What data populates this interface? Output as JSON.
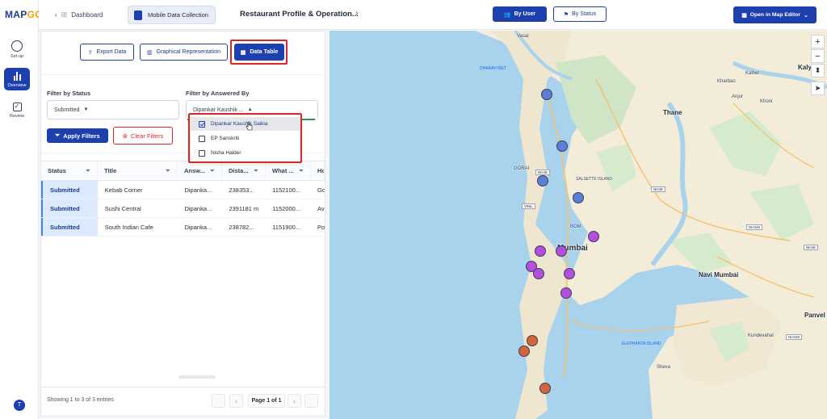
{
  "app": {
    "logo_main": "MAP",
    "logo_accent": "GG"
  },
  "rail": {
    "items": [
      {
        "label": "Set up",
        "icon": "gear-icon"
      },
      {
        "label": "Overview",
        "icon": "bar-chart-icon"
      },
      {
        "label": "Review",
        "icon": "checkbox-icon"
      }
    ],
    "avatar_initial": "T"
  },
  "topbar": {
    "back_label": "Dashboard",
    "collection_label": "Mobile Data Collection",
    "project_title": "Restaurant Profile & Operation...",
    "by_user_label": "By User",
    "by_status_label": "By Status",
    "open_map_editor_label": "Open in Map Editor"
  },
  "views": {
    "export_label": "Export Data",
    "graphical_label": "Graphical Representation",
    "table_label": "Data Table"
  },
  "filters": {
    "status_label": "Filter by Status",
    "status_value": "Submitted",
    "answered_by_label": "Filter by Answered By",
    "answered_by_value": "Dipankar Kaushik ...",
    "apply_label": "Apply Filters",
    "clear_label": "Clear Filters",
    "options": [
      {
        "label": "Dipankar Kaushik Saikia",
        "checked": true
      },
      {
        "label": "EP Sanskriti",
        "checked": false
      },
      {
        "label": "Nisha Halder",
        "checked": false
      }
    ]
  },
  "table": {
    "columns": [
      "Status",
      "Title",
      "Answ...",
      "Dista...",
      "What ...",
      "Ho"
    ],
    "rows": [
      [
        "Submitted",
        "Kebab Corner",
        "Dipanka...",
        "238353...",
        "1152100...",
        "Go"
      ],
      [
        "Submitted",
        "Sushi Central",
        "Dipanka...",
        "2391181 m",
        "1152000...",
        "Av"
      ],
      [
        "Submitted",
        "South Indian Cafe",
        "Dipanka...",
        "238782...",
        "1151900...",
        "Po"
      ]
    ]
  },
  "pagination": {
    "summary": "Showing 1 to 3 of 3 entries",
    "page_label": "Page 1 of 1"
  },
  "map": {
    "labels": {
      "thane": "Thane",
      "mumbai": "Mumbai",
      "navi_mumbai": "Navi Mumbai",
      "panvel": "Panvel",
      "kalyan": "Kaly",
      "salsette": "SALSETTE ISLAND",
      "bom": "BOM",
      "kundevahal": "Kundevahal",
      "sheva": "Sheva",
      "vasai": "Vasai",
      "gorai": "GORAI",
      "anjur": "Anjur",
      "khoni": "Khoni",
      "kharbao": "Kharbao",
      "kalher": "Kalher",
      "elephanta": "ELEPHANTA ISLAND",
      "dharavi_bet": "DHARAVI BET"
    },
    "zoom_in": "+",
    "zoom_out": "−",
    "markers": [
      {
        "color": "blue",
        "count": 4
      },
      {
        "color": "purple",
        "count": 7
      },
      {
        "color": "orange",
        "count": 3
      }
    ],
    "colors": {
      "blue": "#5b7ed8",
      "purple": "#b44ee0",
      "orange": "#d4653a"
    }
  }
}
